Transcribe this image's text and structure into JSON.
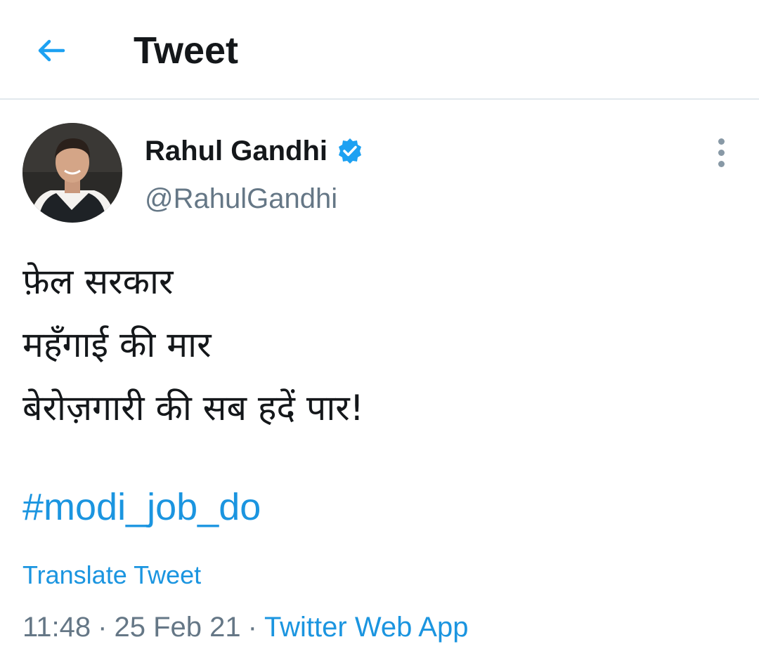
{
  "header": {
    "back_icon": "arrow-left-icon",
    "title": "Tweet",
    "accent_color": "#1da1f2"
  },
  "tweet": {
    "author": {
      "name": "Rahul Gandhi",
      "handle": "@RahulGandhi",
      "verified": true,
      "verified_icon": "verified-badge-icon"
    },
    "more_icon": "more-vertical-icon",
    "lines": [
      "फ़ेल सरकार",
      "महँगाई की मार",
      "बेरोज़गारी की सब हदें पार!"
    ],
    "hashtag": "#modi_job_do",
    "translate_label": "Translate Tweet",
    "time": "11:48",
    "separator": "·",
    "date": "25 Feb 21",
    "source": "Twitter Web App",
    "link_color": "#1b95e0",
    "meta_color": "#657786"
  }
}
